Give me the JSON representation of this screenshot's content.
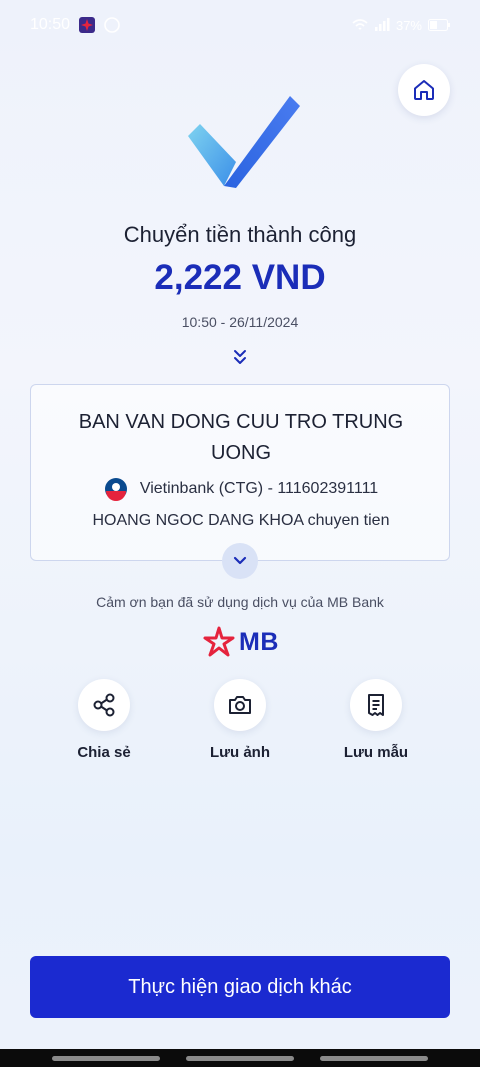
{
  "status_bar": {
    "time": "10:50",
    "battery": "37%"
  },
  "header": {
    "home_icon": "home-icon"
  },
  "result": {
    "title": "Chuyển tiền thành công",
    "amount": "2,222 VND",
    "datetime": "10:50 - 26/11/2024"
  },
  "recipient": {
    "name": "BAN VAN DONG CUU TRO TRUNG UONG",
    "bank_account": "Vietinbank (CTG) - 111602391111",
    "memo": "HOANG NGOC DANG KHOA chuyen tien"
  },
  "thanks_text": "Cảm ơn bạn đã sử dụng dịch vụ của MB Bank",
  "brand": {
    "logo_text": "MB",
    "color": "#1b2db8",
    "accent": "#e5233d"
  },
  "actions": [
    {
      "label": "Chia sẻ",
      "icon": "share-icon"
    },
    {
      "label": "Lưu ảnh",
      "icon": "camera-icon"
    },
    {
      "label": "Lưu mẫu",
      "icon": "receipt-icon"
    }
  ],
  "primary_button": {
    "label": "Thực hiện giao dịch khác"
  }
}
